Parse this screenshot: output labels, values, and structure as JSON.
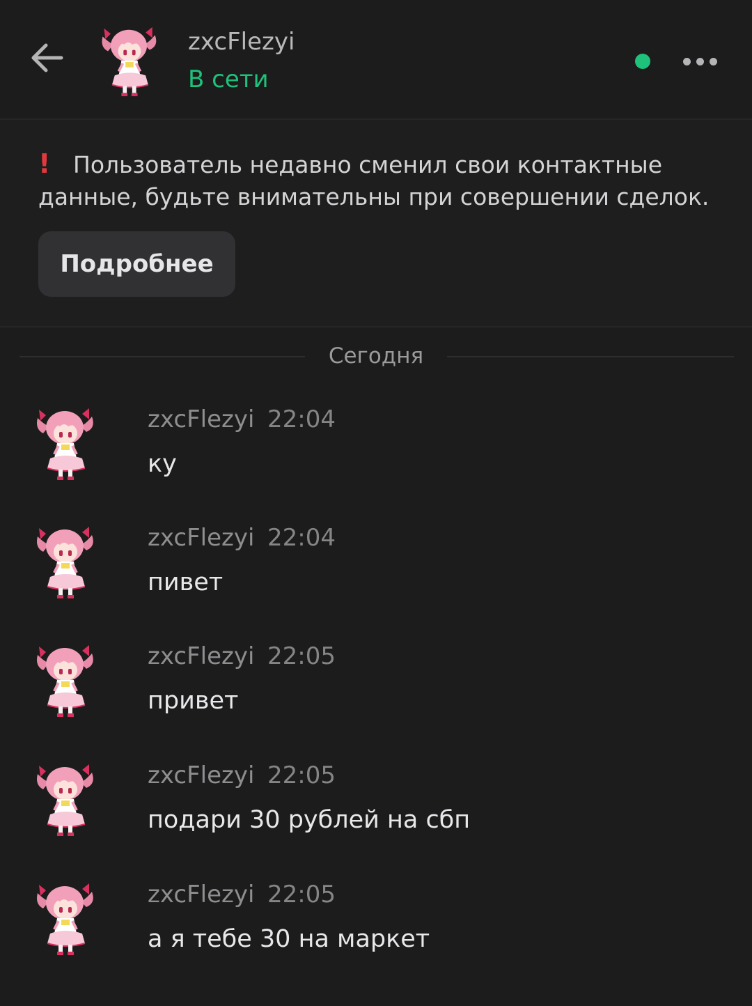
{
  "header": {
    "name": "zxcFlezyi",
    "status": "В сети",
    "status_color": "#1ec27a",
    "back_icon": "arrow-left-icon",
    "more_icon": "more-dots-icon"
  },
  "notice": {
    "icon": "exclamation-icon",
    "text": "Пользователь недавно сменил свои контактные данные, будьте внимательны при совершении сделок.",
    "button_label": "Подробнее"
  },
  "day_separator": "Сегодня",
  "messages": [
    {
      "author": "zxcFlezyi",
      "time": "22:04",
      "text": "ку"
    },
    {
      "author": "zxcFlezyi",
      "time": "22:04",
      "text": "пивет"
    },
    {
      "author": "zxcFlezyi",
      "time": "22:05",
      "text": "привет"
    },
    {
      "author": "zxcFlezyi",
      "time": "22:05",
      "text": "подари 30 рублей на сбп"
    },
    {
      "author": "zxcFlezyi",
      "time": "22:05",
      "text": "а я тебе 30 на маркет"
    }
  ]
}
